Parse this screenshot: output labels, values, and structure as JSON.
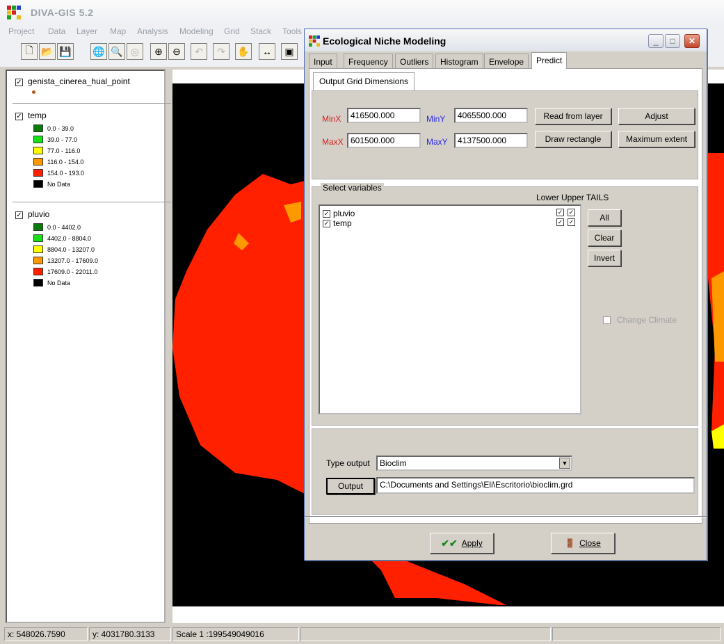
{
  "app": {
    "title": "DIVA-GIS 5.2"
  },
  "menu": [
    "Project",
    "Data",
    "Layer",
    "Map",
    "Analysis",
    "Modeling",
    "Grid",
    "Stack",
    "Tools"
  ],
  "legend": {
    "points_layer": "genista_cinerea_hual_point",
    "temp": {
      "title": "temp",
      "items": [
        {
          "label": "0.0 - 39.0",
          "color": "#0a7a0a"
        },
        {
          "label": "39.0 - 77.0",
          "color": "#18e018"
        },
        {
          "label": "77.0 - 116.0",
          "color": "#ffff00"
        },
        {
          "label": "116.0 - 154.0",
          "color": "#ff9900"
        },
        {
          "label": "154.0 - 193.0",
          "color": "#ff2000"
        },
        {
          "label": "No Data",
          "color": "#000000"
        }
      ]
    },
    "pluvio": {
      "title": "pluvio",
      "items": [
        {
          "label": "0.0 - 4402.0",
          "color": "#0a7a0a"
        },
        {
          "label": "4402.0 - 8804.0",
          "color": "#18e018"
        },
        {
          "label": "8804.0 - 13207.0",
          "color": "#ffff00"
        },
        {
          "label": "13207.0 - 17609.0",
          "color": "#ff9900"
        },
        {
          "label": "17609.0 - 22011.0",
          "color": "#ff2000"
        },
        {
          "label": "No Data",
          "color": "#000000"
        }
      ]
    }
  },
  "status": {
    "x": "x: 548026.7590",
    "y": "y: 4031780.3133",
    "scale": "Scale 1 :199549049016"
  },
  "dialog": {
    "title": "Ecological Niche Modeling",
    "tabs": [
      "Input",
      "Frequency",
      "Outliers",
      "Histogram",
      "Envelope",
      "Predict"
    ],
    "active_tab": "Predict",
    "subtab": "Output Grid Dimensions",
    "minx_label": "MinX",
    "minx": "416500.000",
    "miny_label": "MinY",
    "miny": "4065500.000",
    "maxx_label": "MaxX",
    "maxx": "601500.000",
    "maxy_label": "MaxY",
    "maxy": "4137500.000",
    "read_from_layer": "Read from layer",
    "adjust": "Adjust",
    "draw_rectangle": "Draw rectangle",
    "maximum_extent": "Maximum extent",
    "select_variables": "Select variables",
    "tails_header": "Lower Upper TAILS",
    "variables": [
      "pluvio",
      "temp"
    ],
    "all": "All",
    "clear": "Clear",
    "invert": "Invert",
    "change_climate": "Change Climate",
    "type_output_label": "Type output",
    "type_output_value": "Bioclim",
    "output_button": "Output",
    "output_path": "C:\\Documents and Settings\\Eli\\Escritorio\\bioclim.grd",
    "apply": "Apply",
    "close": "Close"
  }
}
